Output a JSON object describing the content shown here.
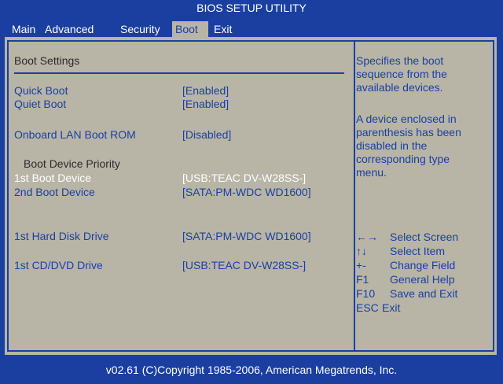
{
  "title": "BIOS SETUP UTILITY",
  "menu": [
    "Main",
    "Advanced",
    "Security",
    "Boot",
    "Exit"
  ],
  "active_menu": "Boot",
  "section_heading": "Boot Settings",
  "settings": {
    "quick_boot": {
      "label": "Quick Boot",
      "value": "[Enabled]"
    },
    "quiet_boot": {
      "label": "Quiet Boot",
      "value": "[Enabled]"
    },
    "lan_boot": {
      "label": "Onboard LAN Boot ROM",
      "value": "[Disabled]"
    },
    "priority_heading": "Boot Device Priority",
    "boot1": {
      "label": "1st Boot Device",
      "value": "[USB:TEAC DV-W28SS-]"
    },
    "boot2": {
      "label": "2nd Boot Device",
      "value": "[SATA:PM-WDC WD1600]"
    },
    "hdd1": {
      "label": "1st Hard Disk Drive",
      "value": "[SATA:PM-WDC WD1600]"
    },
    "cd1": {
      "label": "1st CD/DVD Drive",
      "value": "[USB:TEAC DV-W28SS-]"
    }
  },
  "help": {
    "p1": "Specifies the boot\nsequence from the\navailable devices.",
    "p2": "A device enclosed in\nparenthesis has been\ndisabled in the\ncorresponding type\nmenu."
  },
  "keys": [
    {
      "key": "←→",
      "desc": "Select Screen"
    },
    {
      "key": "↑↓",
      "desc": "Select Item"
    },
    {
      "key": "+-",
      "desc": "Change Field"
    },
    {
      "key": "F1",
      "desc": "General Help"
    },
    {
      "key": "F10",
      "desc": "Save and Exit"
    },
    {
      "key": "ESC",
      "desc": "Exit"
    }
  ],
  "footer": "v02.61  (C)Copyright 1985-2006, American Megatrends, Inc.",
  "colors": {
    "background": "#1a3fa0",
    "panel": "#b8b5a7",
    "text": "#1a3fa0",
    "selected": "#ffffff"
  }
}
